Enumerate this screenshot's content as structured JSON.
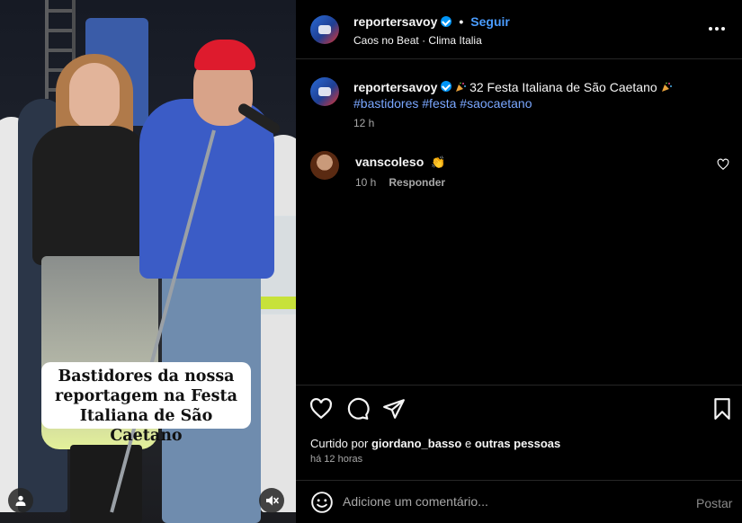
{
  "media": {
    "caption_lines": [
      "Bastidores da nossa",
      "reportagem na Festa",
      "Italiana de São Caetano"
    ],
    "tag_icon": "user-tag-icon",
    "mute_icon": "speaker-muted-icon"
  },
  "header": {
    "username": "reportersavoy",
    "separator": "•",
    "follow_label": "Seguir",
    "audio": "Caos no Beat",
    "audio_sep": "·",
    "location": "Clima Italia",
    "more_icon": "more-options-icon"
  },
  "caption": {
    "username": "reportersavoy",
    "text": "32 Festa Italiana de São Caetano",
    "hashtags": "#bastidores #festa #saocaetano",
    "time": "12 h"
  },
  "comments": [
    {
      "username": "vanscoleso",
      "emoji": "👏",
      "time": "10 h",
      "reply_label": "Responder"
    }
  ],
  "actions": {
    "liked_prefix": "Curtido por",
    "liked_user": "giordano_basso",
    "liked_conj": "e",
    "liked_others": "outras pessoas",
    "timestamp": "há 12 horas"
  },
  "composer": {
    "placeholder": "Adicione um comentário...",
    "post_label": "Postar"
  },
  "colors": {
    "background": "#000000",
    "link": "#4a9cff",
    "hashtag": "#7aa7ff",
    "muted_text": "#a8a8a8",
    "verified": "#0095f6"
  }
}
